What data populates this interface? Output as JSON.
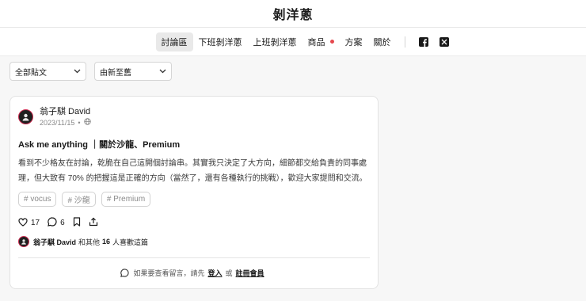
{
  "site": {
    "title": "剝洋蔥"
  },
  "nav": {
    "items": [
      {
        "label": "討論區",
        "active": true
      },
      {
        "label": "下班剝洋蔥"
      },
      {
        "label": "上班剝洋蔥"
      },
      {
        "label": "商品",
        "badge": true
      },
      {
        "label": "方案"
      },
      {
        "label": "關於"
      }
    ],
    "social": [
      "facebook-icon",
      "x-icon"
    ]
  },
  "filters": {
    "category": {
      "selected": "全部貼文"
    },
    "sort": {
      "selected": "由新至舊"
    }
  },
  "post": {
    "author": "翁子騏 David",
    "date": "2023/11/15",
    "title": "Ask me anything ｜關於沙龍、Premium",
    "body": "看到不少格友在討論，乾脆在自己這開個討論串。其實我只決定了大方向，細節都交給負責的同事處理，但大致有 70% 的把握這是正確的方向（當然了，還有各種執行的挑戰），歡迎大家提問和交流。",
    "tags": [
      "# vocus",
      "# 沙龍",
      "# Premium"
    ],
    "like_count": "17",
    "comment_count": "6",
    "likes_summary": {
      "name": "翁子騏 David",
      "and_others": "和其他",
      "count": "16",
      "suffix": "人喜歡這篇"
    },
    "comment_prompt": {
      "prefix": "如果要查看留言，請先",
      "login": "登入",
      "or": "或",
      "register": "註冊會員"
    }
  },
  "colors": {
    "badge": "#e5484d",
    "avatar_ring": "#c82a4f"
  }
}
